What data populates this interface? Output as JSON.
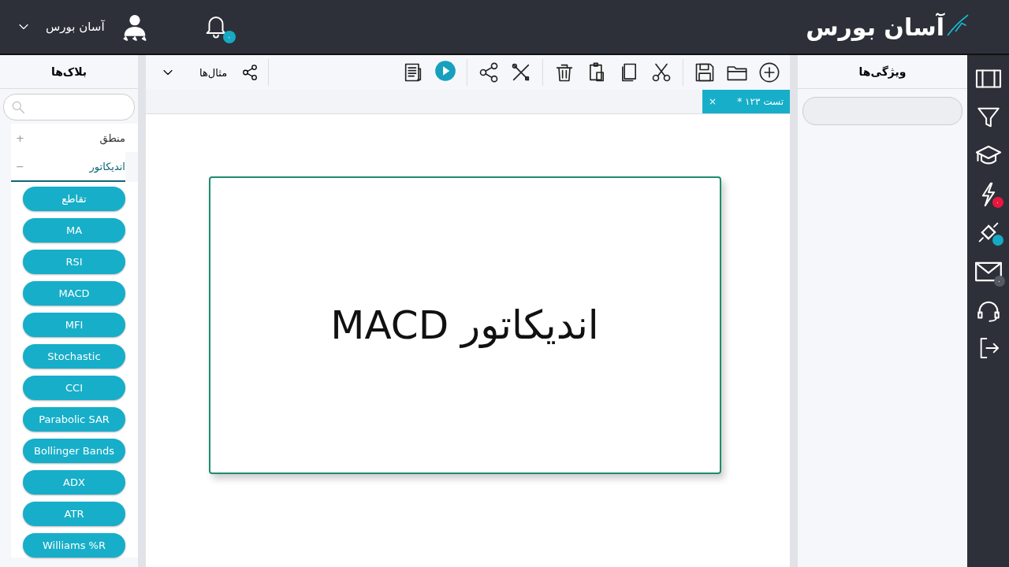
{
  "header": {
    "logo": "آسان بورس",
    "user": {
      "name": "آسان بورس"
    },
    "notifications": {
      "badge": "۰"
    }
  },
  "blocks_panel": {
    "title": "بلاک‌ها",
    "categories": [
      {
        "label": "منطق",
        "expanded": false,
        "toggle": "+"
      },
      {
        "label": "اندیکاتور",
        "expanded": true,
        "toggle": "−",
        "blocks": [
          "تقاطع",
          "MA",
          "RSI",
          "MACD",
          "MFI",
          "Stochastic",
          "CCI",
          "Parabolic SAR",
          "Bollinger Bands",
          "ADX",
          "ATR",
          "Williams %R"
        ]
      }
    ]
  },
  "toolbar": {
    "examples": "مثال‌ها"
  },
  "tabs": [
    {
      "label": "تست ۱۲۳ *",
      "selected": true,
      "close": "×"
    }
  ],
  "canvas": {
    "card_text": "اندیکاتور MACD"
  },
  "properties_panel": {
    "title": "ویژگی‌ها"
  },
  "rail": [
    {
      "kind": "columns"
    },
    {
      "kind": "filter"
    },
    {
      "kind": "cap"
    },
    {
      "kind": "bolt",
      "badge": "۰",
      "color": "#e8173f"
    },
    {
      "kind": "plug",
      "color": "#17a9c3"
    },
    {
      "kind": "mail",
      "badge": "۰",
      "color": "#555962"
    },
    {
      "kind": "headset"
    },
    {
      "kind": "logout"
    }
  ]
}
